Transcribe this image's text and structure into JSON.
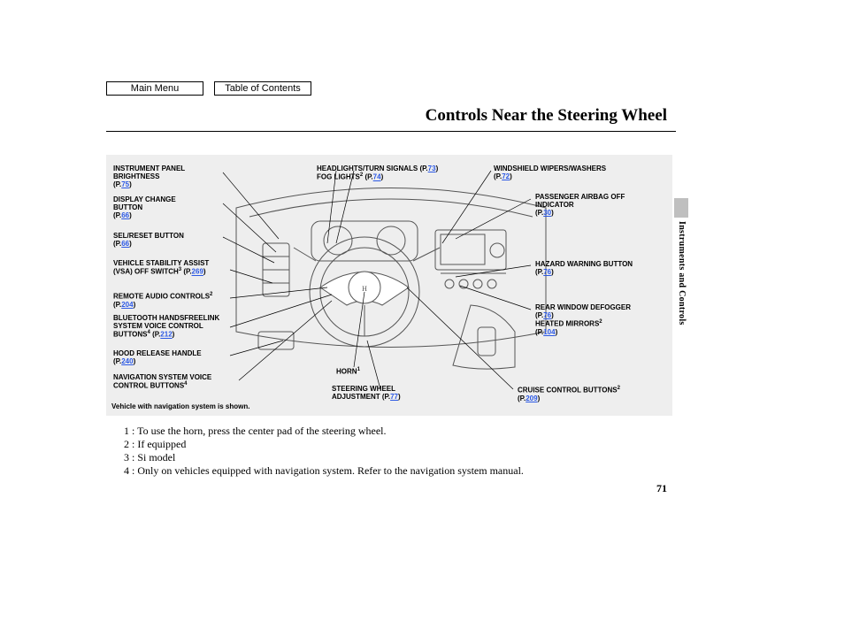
{
  "nav": {
    "main_menu": "Main Menu",
    "toc": "Table of Contents"
  },
  "title": "Controls Near the Steering Wheel",
  "side_section": "Instruments and Controls",
  "page_number": "71",
  "left": {
    "ipb": {
      "label": "INSTRUMENT PANEL\nBRIGHTNESS",
      "page": "75"
    },
    "display": {
      "label": "DISPLAY CHANGE\nBUTTON",
      "page": "66"
    },
    "selreset": {
      "label": "SEL/RESET BUTTON",
      "page": "66"
    },
    "vsa": {
      "label": "VEHICLE STABILITY ASSIST\n(VSA) OFF SWITCH",
      "sup": "3",
      "page": "269"
    },
    "audio": {
      "label": "REMOTE AUDIO CONTROLS",
      "sup": "2",
      "page": "204"
    },
    "bt": {
      "label": "BLUETOOTH HANDSFREELINK\nSYSTEM VOICE CONTROL\nBUTTONS",
      "sup": "4",
      "page": "212"
    },
    "hood": {
      "label": "HOOD RELEASE HANDLE",
      "page": "240"
    },
    "navvoice": {
      "label": "NAVIGATION SYSTEM VOICE\nCONTROL BUTTONS",
      "sup": "4"
    }
  },
  "center": {
    "headlights": {
      "label": "HEADLIGHTS/TURN SIGNALS",
      "page": "73"
    },
    "fog": {
      "label": "FOG LIGHTS",
      "sup": "2",
      "page": "74"
    },
    "horn": {
      "label": "HORN",
      "sup": "1"
    },
    "swadj": {
      "label": "STEERING WHEEL\nADJUSTMENT",
      "page": "77"
    }
  },
  "right": {
    "wipers": {
      "label": "WINDSHIELD WIPERS/WASHERS",
      "page": "72"
    },
    "airbag": {
      "label": "PASSENGER AIRBAG OFF\nINDICATOR",
      "page": "30"
    },
    "hazard": {
      "label": "HAZARD WARNING BUTTON",
      "page": "76"
    },
    "defog": {
      "label": "REAR WINDOW DEFOGGER",
      "page": "76"
    },
    "mirrors": {
      "label": "HEATED MIRRORS",
      "sup": "2",
      "page": "104"
    },
    "cruise": {
      "label": "CRUISE CONTROL BUTTONS",
      "sup": "2",
      "page": "209"
    }
  },
  "caption": "Vehicle with navigation system is shown.",
  "footnotes": {
    "f1": "1 :  To use the horn, press the center pad of the steering wheel.",
    "f2": "2 :  If equipped",
    "f3": "3 :  Si model",
    "f4": "4 :  Only on vehicles equipped with navigation system. Refer to the navigation system manual."
  }
}
